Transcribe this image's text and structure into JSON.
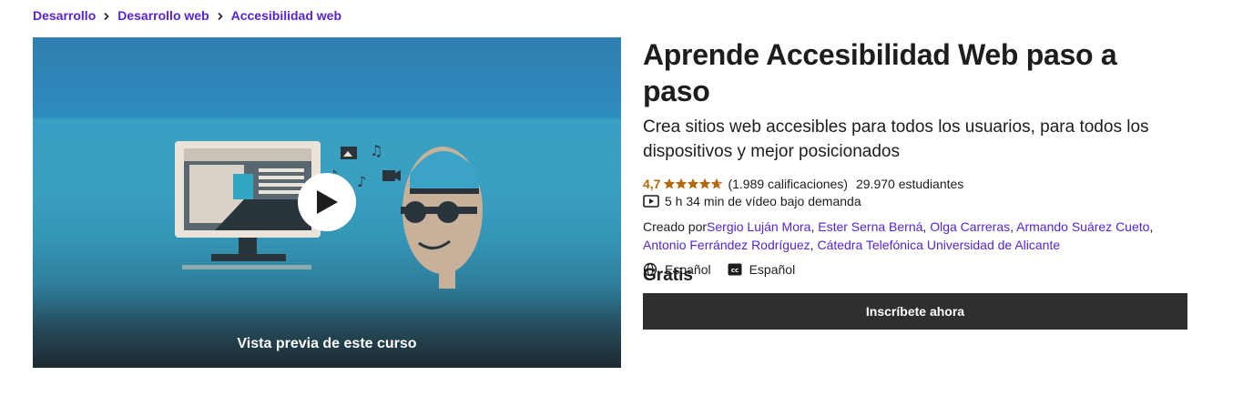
{
  "breadcrumb": [
    {
      "label": "Desarrollo"
    },
    {
      "label": "Desarrollo web"
    },
    {
      "label": "Accesibilidad web"
    }
  ],
  "preview": {
    "label": "Vista previa de este curso"
  },
  "course": {
    "title": "Aprende Accesibilidad Web paso a paso",
    "subtitle": "Crea sitios web accesibles para todos los usuarios, para todos los dispositivos y mejor posicionados",
    "rating_value": "4,7",
    "rating_stars": 4.7,
    "rating_count": "(1.989 calificaciones)",
    "students": "29.970 estudiantes",
    "duration": "5 h 34 min de vídeo bajo demanda",
    "created_by_label": "Creado por",
    "authors": [
      "Sergio Luján Mora",
      "Ester Serna Berná",
      "Olga Carreras",
      "Armando Suárez Cueto",
      "Antonio Ferrández Rodríguez",
      "Cátedra Telefónica Universidad de Alicante"
    ],
    "audio_language": "Español",
    "caption_language": "Español",
    "price": "Gratis",
    "enroll_label": "Inscríbete ahora"
  },
  "colors": {
    "link": "#5624d0",
    "rating": "#b4690e",
    "button_bg": "#2d2f31"
  },
  "icons": {
    "breadcrumb_separator": "chevron-right-icon",
    "play": "play-icon",
    "video": "video-icon",
    "language": "globe-icon",
    "captions": "closed-captions-icon"
  }
}
